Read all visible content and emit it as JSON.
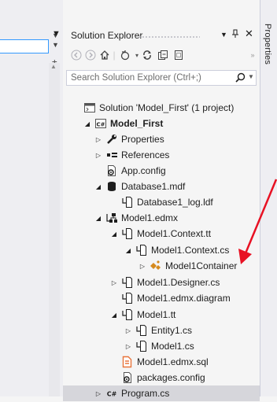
{
  "solution_explorer": {
    "title": "Solution Explorer",
    "search_placeholder": "Search Solution Explorer (Ctrl+;)",
    "tree": [
      {
        "label": "Solution 'Model_First' (1 project)",
        "icon": "solution-icon",
        "expander": ""
      },
      {
        "label": "Model_First",
        "icon": "csharp-project-icon",
        "expander": "expanded",
        "bold": true
      },
      {
        "label": "Properties",
        "icon": "wrench-icon",
        "expander": "collapsed"
      },
      {
        "label": "References",
        "icon": "references-icon",
        "expander": "collapsed"
      },
      {
        "label": "App.config",
        "icon": "config-file-icon",
        "expander": ""
      },
      {
        "label": "Database1.mdf",
        "icon": "database-icon",
        "expander": "expanded"
      },
      {
        "label": "Database1_log.ldf",
        "icon": "dependent-file-icon",
        "expander": ""
      },
      {
        "label": "Model1.edmx",
        "icon": "edmx-icon",
        "expander": "expanded"
      },
      {
        "label": "Model1.Context.tt",
        "icon": "dependent-file-icon",
        "expander": "expanded"
      },
      {
        "label": "Model1.Context.cs",
        "icon": "dependent-file-icon",
        "expander": "expanded"
      },
      {
        "label": "Model1Container",
        "icon": "class-icon",
        "expander": "collapsed"
      },
      {
        "label": "Model1.Designer.cs",
        "icon": "dependent-file-icon",
        "expander": "collapsed"
      },
      {
        "label": "Model1.edmx.diagram",
        "icon": "dependent-file-icon",
        "expander": ""
      },
      {
        "label": "Model1.tt",
        "icon": "dependent-file-icon",
        "expander": "expanded"
      },
      {
        "label": "Entity1.cs",
        "icon": "dependent-file-icon",
        "expander": "collapsed"
      },
      {
        "label": "Model1.cs",
        "icon": "dependent-file-icon",
        "expander": "collapsed"
      },
      {
        "label": "Model1.edmx.sql",
        "icon": "sql-file-icon",
        "expander": ""
      },
      {
        "label": "packages.config",
        "icon": "config-file-icon",
        "expander": ""
      },
      {
        "label": "Program.cs",
        "icon": "csharp-file-icon",
        "expander": "collapsed",
        "selected": true
      }
    ]
  },
  "properties_tab": {
    "label": "Properties"
  },
  "colors": {
    "accent": "#3399ff",
    "selection": "#d6d6db",
    "annotation_arrow": "#e81123",
    "sql_icon": "#e8743b",
    "class_icon": "#d68a1e"
  }
}
